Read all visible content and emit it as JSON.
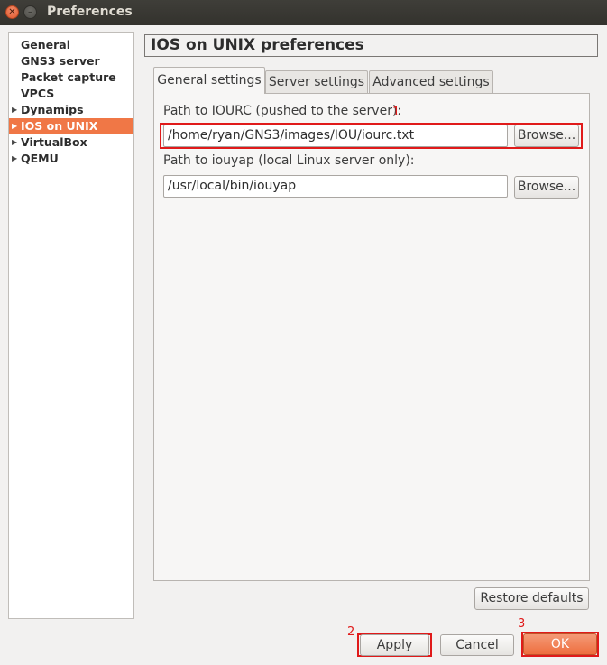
{
  "window": {
    "title": "Preferences"
  },
  "sidebar": {
    "items": [
      {
        "label": "General",
        "expandable": false,
        "selected": false
      },
      {
        "label": "GNS3 server",
        "expandable": false,
        "selected": false
      },
      {
        "label": "Packet capture",
        "expandable": false,
        "selected": false
      },
      {
        "label": "VPCS",
        "expandable": false,
        "selected": false
      },
      {
        "label": "Dynamips",
        "expandable": true,
        "selected": false
      },
      {
        "label": "IOS on UNIX",
        "expandable": true,
        "selected": true
      },
      {
        "label": "VirtualBox",
        "expandable": true,
        "selected": false
      },
      {
        "label": "QEMU",
        "expandable": true,
        "selected": false
      }
    ]
  },
  "page": {
    "title": "IOS on UNIX preferences"
  },
  "tabs": [
    {
      "label": "General settings",
      "active": true
    },
    {
      "label": "Server settings",
      "active": false
    },
    {
      "label": "Advanced settings",
      "active": false
    }
  ],
  "general": {
    "iourc_label": "Path to IOURC (pushed to the server):",
    "iourc_value": "/home/ryan/GNS3/images/IOU/iourc.txt",
    "iouyap_label": "Path to iouyap (local Linux server only):",
    "iouyap_value": "/usr/local/bin/iouyap",
    "browse_label": "Browse..."
  },
  "restore_defaults_label": "Restore defaults",
  "dialog_buttons": {
    "apply": "Apply",
    "cancel": "Cancel",
    "ok": "OK"
  },
  "annotations": {
    "m1": "1",
    "m2": "2",
    "m3": "3"
  },
  "colors": {
    "accent": "#f07746",
    "highlight": "#e01a1a",
    "titlebar": "#3c3b37"
  }
}
